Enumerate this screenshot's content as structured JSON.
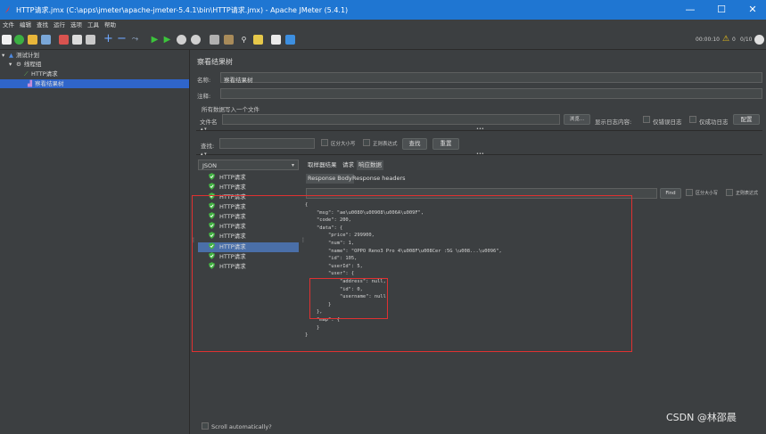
{
  "window": {
    "title": "HTTP请求.jmx (C:\\apps\\jmeter\\apache-jmeter-5.4.1\\bin\\HTTP请求.jmx) - Apache JMeter (5.4.1)",
    "minimize": "—",
    "maximize": "☐",
    "close": "✕"
  },
  "menu": [
    "文件",
    "编辑",
    "查找",
    "运行",
    "选项",
    "工具",
    "帮助"
  ],
  "toolbar": {
    "timer": "00:00:10",
    "warnings": "0",
    "threads": "0/10"
  },
  "tree": {
    "items": [
      {
        "label": "测试计划",
        "icon": "test-plan-icon"
      },
      {
        "label": "线程组",
        "icon": "gear-icon"
      },
      {
        "label": "HTTP请求",
        "icon": "pipette-icon"
      },
      {
        "label": "察看结果树",
        "icon": "chart-icon"
      }
    ]
  },
  "panel": {
    "title": "察看结果树",
    "name_label": "名称:",
    "name_value": "察看结果树",
    "comment_label": "注释:",
    "group_title": "所有数据写入一个文件",
    "filename_label": "文件名",
    "browse_button": "浏览...",
    "log_only_label": "显示日志内容:",
    "errors_only": "仅错误日志",
    "success_only": "仅成功日志",
    "configure_button": "配置",
    "search_label": "查找:",
    "case_sensitive": "区分大小写",
    "regex": "正则表达式",
    "search_button": "查找",
    "reset_button": "重置",
    "renderer": "JSON",
    "scroll_auto": "Scroll automatically?"
  },
  "results": {
    "items": [
      "HTTP请求",
      "HTTP请求",
      "HTTP请求",
      "HTTP请求",
      "HTTP请求",
      "HTTP请求",
      "HTTP请求",
      "HTTP请求",
      "HTTP请求",
      "HTTP请求"
    ],
    "selected_index": 7
  },
  "tabs": {
    "main": [
      "取样器结果",
      "请求",
      "响应数据"
    ],
    "active_main": 2,
    "sub": [
      "Response Body",
      "Response headers"
    ],
    "active_sub": 0
  },
  "response": {
    "find_button": "Find",
    "case_sensitive": "区分大小写",
    "regex": "正则表达式",
    "body": "{\n    \"msg\": \"ae\\u0080\\u00908\\u006A\\u009F\",\n    \"code\": 200,\n    \"data\": {\n        \"price\": 299900,\n        \"num\": 1,\n        \"name\": \"OPPO Reno3 Pro 4\\u008F\\u008Cer :5G \\u008...\\u0096\",\n        \"id\": 105,\n        \"userId\": 5,\n        \"user\": {\n            \"address\": null,\n            \"id\": 0,\n            \"username\": null\n        }\n    },\n    \"map\": {\n    }\n}"
  },
  "watermark": "CSDN @林邵晨",
  "colors": {
    "accent": "#1f76d2",
    "highlight": "#e03131",
    "success": "#41b341"
  }
}
